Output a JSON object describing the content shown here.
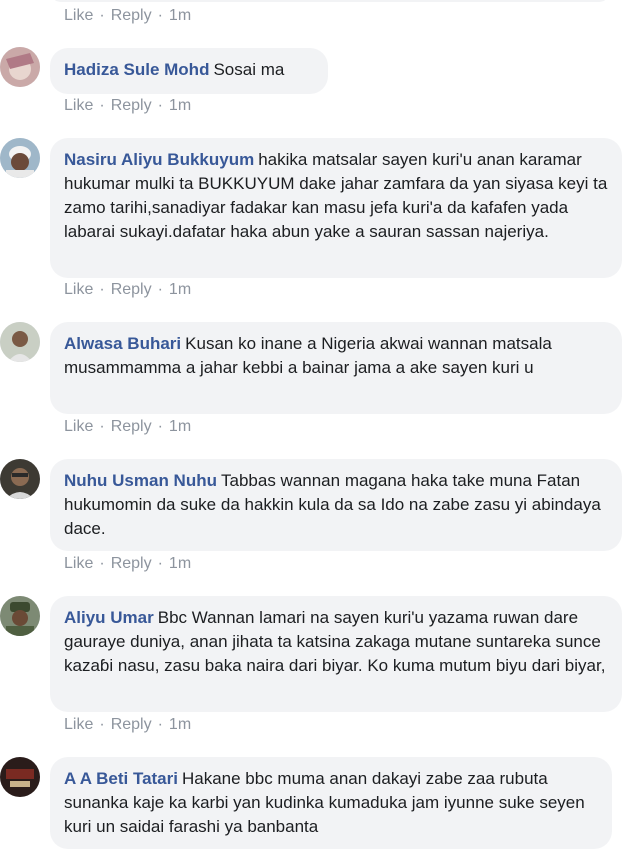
{
  "actions": {
    "like": "Like",
    "reply": "Reply",
    "time": "1m",
    "dot": "·"
  },
  "comments": [
    {
      "author": "Hadiza Sule Mohd",
      "text": "Sosai ma"
    },
    {
      "author": "Nasiru Aliyu Bukkuyum",
      "text": "hakika matsalar sayen kuri'u anan karamar hukumar mulki ta BUKKUYUM dake jahar zamfara da yan siyasa keyi ta zamo tarihi,sanadiyar fadakar kan masu jefa kuri'a da kafafen yada labarai sukayi.dafatar haka abun yake a sauran sassan najeriya."
    },
    {
      "author": "Alwasa Buhari",
      "text": "Kusan ko inane a Nigeria akwai wannan matsala musammamma a jahar kebbi a bainar jama a ake sayen kuri u"
    },
    {
      "author": "Nuhu Usman Nuhu",
      "text": "Tabbas wannan magana haka take muna Fatan hukumomin da suke da hakkin kula da sa Ido na zabe zasu yi abindaya dace."
    },
    {
      "author": "Aliyu Umar",
      "text": "Bbc Wannan lamari na sayen kuri'u yazama ruwan dare gauraye duniya, anan jihata ta katsina zakaga mutane suntareka sunce kazaɓi nasu, zasu baka naira dari biyar. Ko kuma mutum biyu dari biyar,"
    },
    {
      "author": "A A Beti Tatari",
      "text": "Hakane bbc muma anan dakayi zabe zaa rubuta sunanka kaje ka karbi yan kudinka kumaduka jam iyunne suke seyen kuri un saidai farashi ya banbanta"
    }
  ]
}
